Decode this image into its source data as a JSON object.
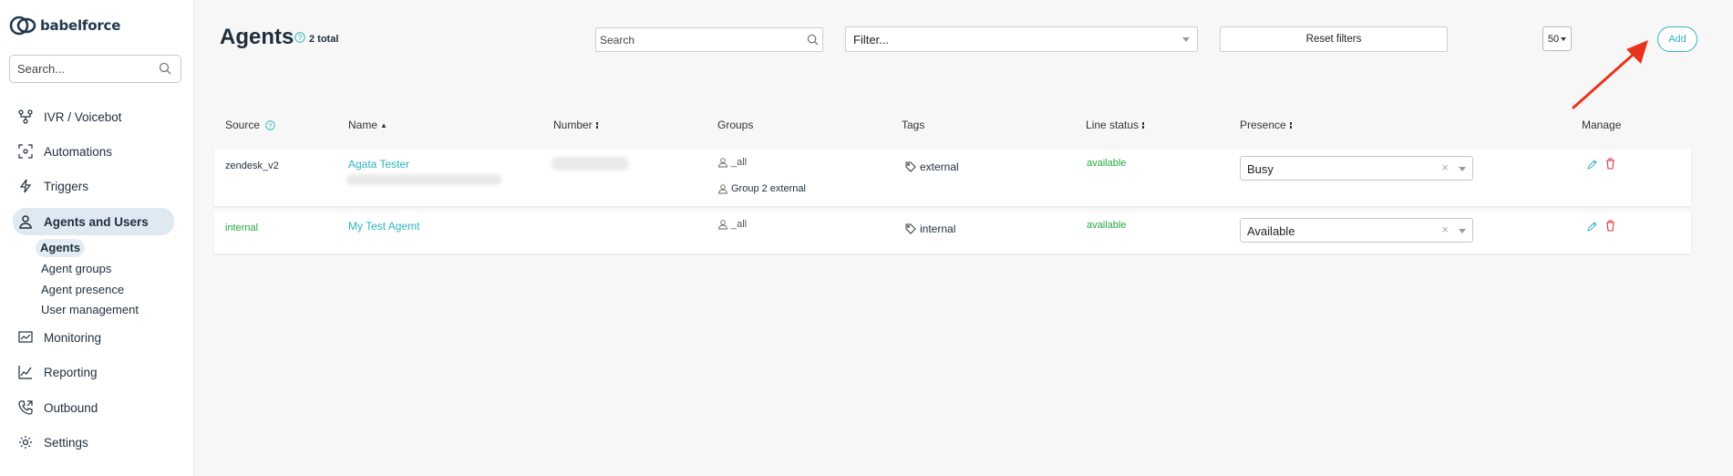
{
  "sidebar": {
    "brand": "babelforce",
    "search_placeholder": "Search...",
    "items": [
      {
        "label": "IVR / Voicebot"
      },
      {
        "label": "Automations"
      },
      {
        "label": "Triggers"
      },
      {
        "label": "Agents and Users"
      },
      {
        "label": "Monitoring"
      },
      {
        "label": "Reporting"
      },
      {
        "label": "Outbound"
      },
      {
        "label": "Settings"
      }
    ],
    "subitems": [
      {
        "label": "Agents"
      },
      {
        "label": "Agent groups"
      },
      {
        "label": "Agent presence"
      },
      {
        "label": "User management"
      }
    ]
  },
  "header": {
    "title": "Agents",
    "total": "2 total",
    "search_placeholder": "Search",
    "filter_placeholder": "Filter...",
    "reset_label": "Reset filters",
    "page_size": "50",
    "add_label": "Add"
  },
  "table": {
    "columns": [
      "Source",
      "Name",
      "Number",
      "Groups",
      "Tags",
      "Line status",
      "Presence",
      "Manage"
    ],
    "rows": [
      {
        "source": "zendesk_v2",
        "name": "Agata Tester",
        "groups": [
          "_all",
          "Group 2 external"
        ],
        "tag": "external",
        "line_status": "available",
        "presence": "Busy"
      },
      {
        "source": "internal",
        "name": "My Test Agemt",
        "groups": [
          "_all"
        ],
        "tag": "internal",
        "line_status": "available",
        "presence": "Available"
      }
    ]
  },
  "colors": {
    "accent": "#2fb5c4",
    "status_green": "#22a93e",
    "delete_red": "#d9363e",
    "annotation_arrow": "#e8341c"
  }
}
